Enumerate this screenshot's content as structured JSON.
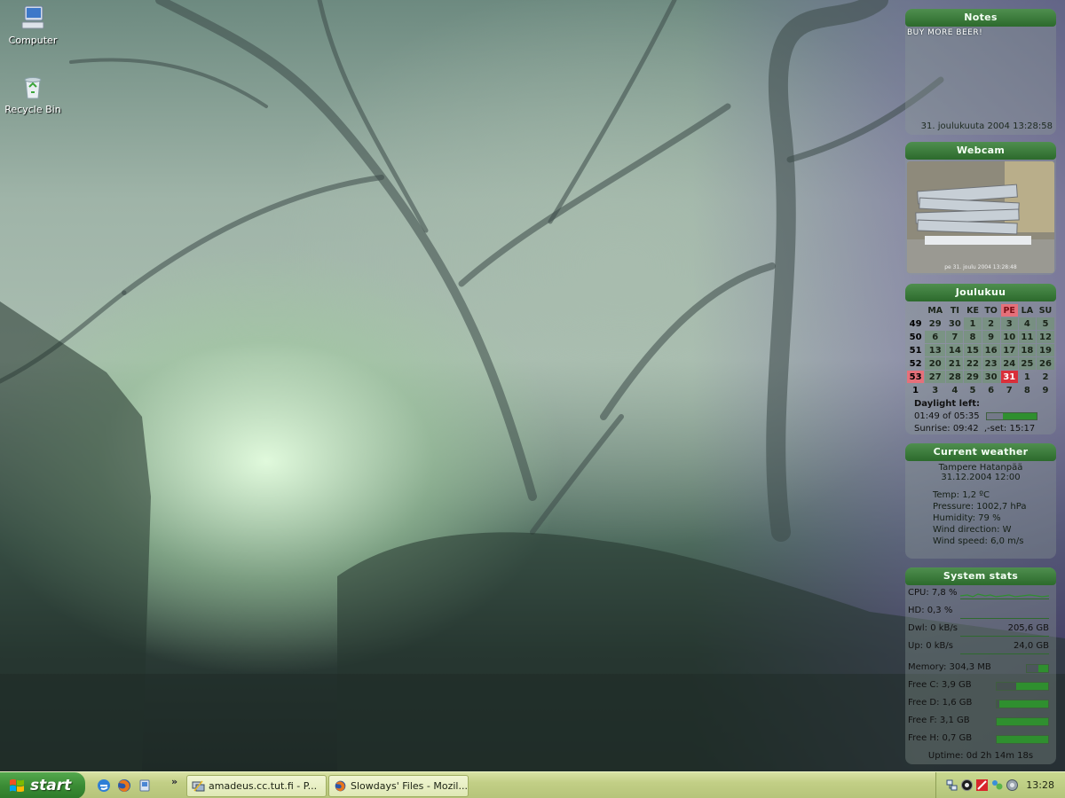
{
  "desktop_icons": [
    {
      "label": "Computer",
      "icon": "computer-icon"
    },
    {
      "label": "Recycle Bin",
      "icon": "recycle-bin-icon"
    }
  ],
  "notes": {
    "title": "Notes",
    "text": "BUY MORE BEER!",
    "date": "31. joulukuuta 2004 13:28:58"
  },
  "webcam": {
    "title": "Webcam",
    "caption": "pe 31. joulu 2004 13:28:48"
  },
  "calendar": {
    "title": "Joulukuu",
    "headers": [
      "",
      "MA",
      "TI",
      "KE",
      "TO",
      "PE",
      "LA",
      "SU"
    ],
    "rows": [
      [
        "49",
        "29",
        "30",
        "1",
        "2",
        "3",
        "4",
        "5"
      ],
      [
        "50",
        "6",
        "7",
        "8",
        "9",
        "10",
        "11",
        "12"
      ],
      [
        "51",
        "13",
        "14",
        "15",
        "16",
        "17",
        "18",
        "19"
      ],
      [
        "52",
        "20",
        "21",
        "22",
        "23",
        "24",
        "25",
        "26"
      ],
      [
        "53",
        "27",
        "28",
        "29",
        "30",
        "31",
        "1",
        "2"
      ],
      [
        "1",
        "3",
        "4",
        "5",
        "6",
        "7",
        "8",
        "9"
      ]
    ],
    "today": "31"
  },
  "daylight": {
    "label": "Daylight left:",
    "value": "01:49 of 05:35",
    "fraction": 0.68,
    "sunrise_label": "Sunrise: 09:42",
    "sunset_label": ",-set: 15:17"
  },
  "weather": {
    "title": "Current weather",
    "location": "Tampere Hatanpää",
    "datetime": "31.12.2004 12:00",
    "temp": "Temp: 1,2 ºC",
    "pressure": "Pressure: 1002,7 hPa",
    "humidity": "Humidity: 79 %",
    "wind_direction": "Wind direction: W",
    "wind_speed": "Wind speed: 6,0 m/s"
  },
  "system_stats": {
    "title": "System stats",
    "cpu": "CPU: 7,8 %",
    "hd": "HD: 0,3 %",
    "dwl_label": "Dwl: 0 kB/s",
    "dwl_total": "205,6 GB",
    "up_label": "Up: 0 kB/s",
    "up_total": "24,0 GB",
    "memory": "Memory: 304,3 MB",
    "memory_fraction": 0.45,
    "drives": [
      {
        "label": "Free C: 3,9 GB",
        "fraction": 0.62
      },
      {
        "label": "Free D: 1,6 GB",
        "fraction": 0.95
      },
      {
        "label": "Free F: 3,1 GB",
        "fraction": 1.0
      },
      {
        "label": "Free H: 0,7 GB",
        "fraction": 1.0
      }
    ],
    "uptime": "Uptime: 0d 2h 14m 18s"
  },
  "taskbar": {
    "start_label": "start",
    "quick_launch": [
      "internet-explorer-icon",
      "firefox-icon",
      "show-desktop-icon"
    ],
    "chevron": "»",
    "tasks": [
      {
        "label": "amadeus.cc.tut.fi - P...",
        "icon": "putty-icon"
      },
      {
        "label": "Slowdays' Files - Mozil...",
        "icon": "firefox-icon"
      }
    ],
    "clock": "13:28"
  },
  "colors": {
    "gadget_title": "#2c6a2c",
    "bar_fill": "#2f8f2f",
    "today": "#d92f3a",
    "taskbar": "#c2cf86",
    "start": "#3b8c35"
  }
}
